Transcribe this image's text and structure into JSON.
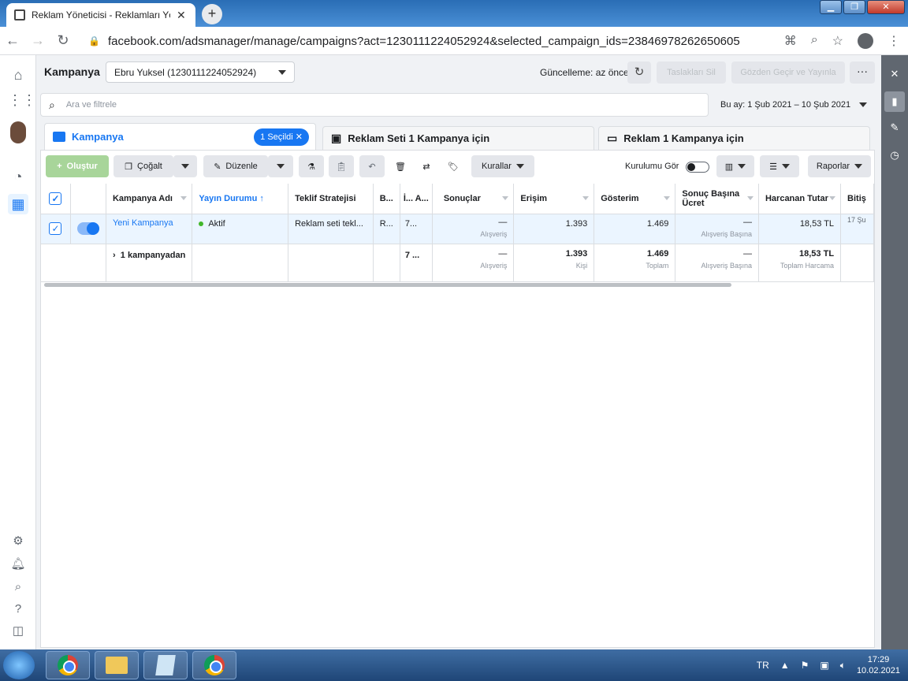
{
  "browser": {
    "tab_title": "Reklam Yöneticisi - Reklamları Yö",
    "url": "facebook.com/adsmanager/manage/campaigns?act=1230111224052924&selected_campaign_ids=23846978262650605"
  },
  "header": {
    "title": "Kampanya",
    "account": "Ebru Yuksel (1230111224052924)",
    "update_status": "Güncelleme: az önce",
    "delete_drafts": "Taslakları Sil",
    "review_publish": "Gözden Geçir ve Yayınla",
    "more": "···"
  },
  "search": {
    "placeholder": "Ara ve filtrele",
    "date_range": "Bu ay: 1 Şub 2021 – 10 Şub 2021"
  },
  "tabs": {
    "campaign": "Kampanya",
    "selected": "1 Seçildi",
    "adset": "Reklam Seti 1 Kampanya için",
    "ad": "Reklam 1 Kampanya için"
  },
  "toolbar": {
    "create": "Oluştur",
    "duplicate": "Çoğalt",
    "edit": "Düzenle",
    "rules": "Kurallar",
    "setup_view": "Kurulumu Gör",
    "reports": "Raporlar"
  },
  "table": {
    "headers": {
      "name": "Kampanya Adı",
      "delivery": "Yayın Durumu ↑",
      "bid": "Teklif Stratejisi",
      "budget": "B...",
      "attr": "İ... A...",
      "results": "Sonuçlar",
      "reach": "Erişim",
      "impressions": "Gösterim",
      "cpr": "Sonuç Başına Ücret",
      "spent": "Harcanan Tutar",
      "end": "Bitiş"
    },
    "row": {
      "name": "Yeni Kampanya",
      "delivery": "Aktif",
      "bid": "Reklam seti tekl...",
      "budget": "R...",
      "attr": "7...",
      "results": "—",
      "results_sub": "Alışveriş",
      "reach": "1.393",
      "impressions": "1.469",
      "cpr": "—",
      "cpr_sub": "Alışveriş Başına",
      "spent": "18,53 TL",
      "end": "17 Şu"
    },
    "summary": {
      "name": "1 kampanyadan",
      "attr": "7 ...",
      "results": "—",
      "results_sub": "Alışveriş",
      "reach": "1.393",
      "reach_sub": "Kişi",
      "impressions": "1.469",
      "impressions_sub": "Toplam",
      "cpr": "—",
      "cpr_sub": "Alışveriş Başına",
      "spent": "18,53 TL",
      "spent_sub": "Toplam Harcama"
    }
  },
  "taskbar": {
    "lang": "TR",
    "time": "17:29",
    "date": "10.02.2021"
  },
  "icons": [
    "home-icon",
    "grid-icon",
    "gauge-icon",
    "table-icon",
    "settings-icon",
    "bell-icon",
    "search-icon",
    "help-icon",
    "chart-icon",
    "pencil-icon",
    "clock-icon"
  ],
  "colors": {
    "brand": "#1877f2",
    "create_green": "#a8d59a",
    "active_dot": "#42b72a"
  }
}
